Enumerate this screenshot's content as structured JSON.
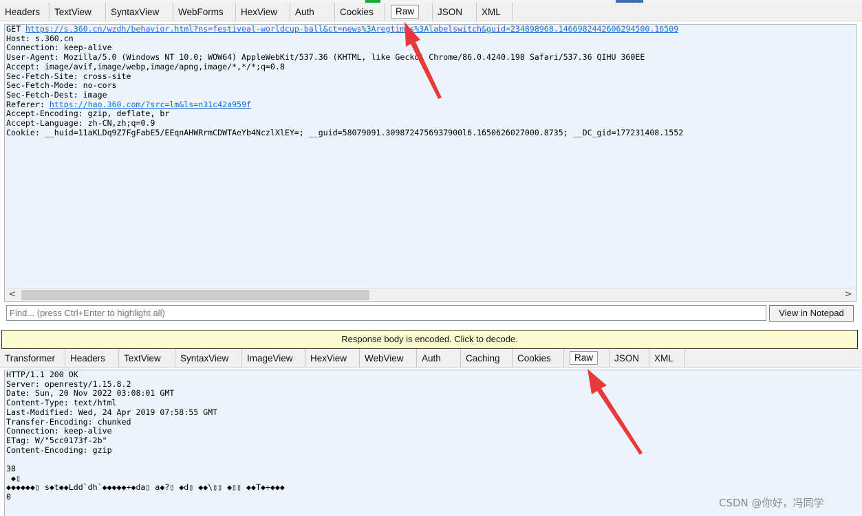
{
  "request_tabs": [
    "Headers",
    "TextView",
    "SyntaxView",
    "WebForms",
    "HexView",
    "Auth",
    "Cookies",
    "Raw",
    "JSON",
    "XML"
  ],
  "request_active_tab": "Raw",
  "request_raw": {
    "method": "GET",
    "url": "https://s.360.cn/wzdh/behavior.html?ns=festiveal-worldcup-ball&ct=news%3Aregtimes%3Alabelswitch&guid=234898968.1466982442606294500.16509",
    "line_host": "Host: s.360.cn",
    "line_connection": "Connection: keep-alive",
    "line_user_agent": "User-Agent: Mozilla/5.0 (Windows NT 10.0; WOW64) AppleWebKit/537.36 (KHTML, like Gecko) Chrome/86.0.4240.198 Safari/537.36 QIHU 360EE",
    "line_accept": "Accept: image/avif,image/webp,image/apng,image/*,*/*;q=0.8",
    "line_sec_site": "Sec-Fetch-Site: cross-site",
    "line_sec_mode": "Sec-Fetch-Mode: no-cors",
    "line_sec_dest": "Sec-Fetch-Dest: image",
    "referer_label": "Referer:",
    "referer_url": "https://hao.360.com/?src=lm&ls=n31c42a959f",
    "line_accept_encoding": "Accept-Encoding: gzip, deflate, br",
    "line_accept_language": "Accept-Language: zh-CN,zh;q=0.9",
    "line_cookie": "Cookie: __huid=11aKLDq9Z7FgFabE5/EEqnAHWRrmCDWTAeYb4NczlXlEY=; __guid=58079091.3098724756937900l6.1650626027000.8735; __DC_gid=177231408.1552"
  },
  "scrollbar": {
    "left_arrow": "<",
    "right_arrow": ">"
  },
  "find": {
    "placeholder": "Find... (press Ctrl+Enter to highlight all)"
  },
  "view_in_notepad": "View in Notepad",
  "encoded_notice": "Response body is encoded. Click to decode.",
  "response_tabs": [
    "Transformer",
    "Headers",
    "TextView",
    "SyntaxView",
    "ImageView",
    "HexView",
    "WebView",
    "Auth",
    "Caching",
    "Cookies",
    "Raw",
    "JSON",
    "XML"
  ],
  "response_active_tab": "Raw",
  "response_raw": {
    "status": "HTTP/1.1 200 OK",
    "server": "Server: openresty/1.15.8.2",
    "date": "Date: Sun, 20 Nov 2022 03:08:01 GMT",
    "content_type": "Content-Type: text/html",
    "last_modified": "Last-Modified: Wed, 24 Apr 2019 07:58:55 GMT",
    "transfer_encoding": "Transfer-Encoding: chunked",
    "connection": "Connection: keep-alive",
    "etag": "ETag: W/\"5cc0173f-2b\"",
    "content_encoding": "Content-Encoding: gzip",
    "chunk_size": "38",
    "body_line1": " ◆▯",
    "body_line2": "◆◆◆◆◆◆▯ s◆t◆◆Ldd`dh`◆◆◆◆◆+◆da▯ a◆?▯ ◆d▯ ◆◆\\▯▯ ◆▯▯ ◆◆T◆+◆◆◆",
    "chunk_end": "0"
  },
  "watermark": "CSDN @你好，冯同学",
  "colors": {
    "pane_bg": "#edf4fb",
    "link": "#1a6ed8",
    "arrow": "#e8393b",
    "notice_bg": "#fcfcd0"
  }
}
